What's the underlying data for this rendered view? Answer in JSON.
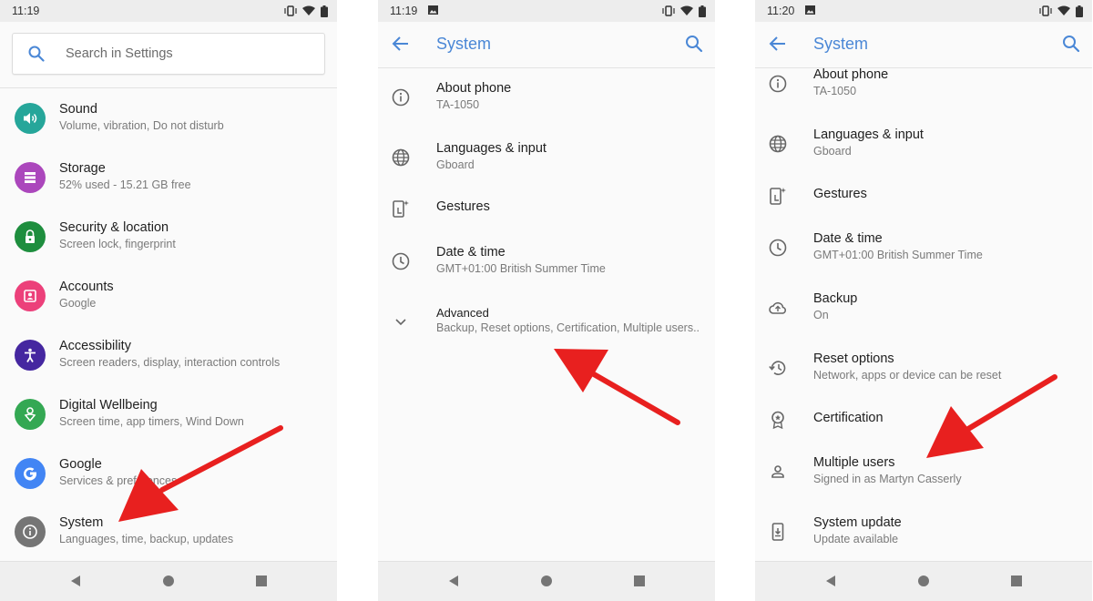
{
  "screens": [
    {
      "status_time": "11:19",
      "search_placeholder": "Search in Settings",
      "items": [
        {
          "title": "Sound",
          "sub": "Volume, vibration, Do not disturb",
          "icon": "volume-icon",
          "color": "#26a69a"
        },
        {
          "title": "Storage",
          "sub": "52% used - 15.21 GB free",
          "icon": "storage-icon",
          "color": "#ab47bc"
        },
        {
          "title": "Security & location",
          "sub": "Screen lock, fingerprint",
          "icon": "lock-icon",
          "color": "#1e8e3e"
        },
        {
          "title": "Accounts",
          "sub": "Google",
          "icon": "account-box-icon",
          "color": "#ec407a"
        },
        {
          "title": "Accessibility",
          "sub": "Screen readers, display, interaction controls",
          "icon": "accessibility-icon",
          "color": "#4527a0"
        },
        {
          "title": "Digital Wellbeing",
          "sub": "Screen time, app timers, Wind Down",
          "icon": "wellbeing-icon",
          "color": "#34a853"
        },
        {
          "title": "Google",
          "sub": "Services & preferences",
          "icon": "google-icon",
          "color": "#4285f4"
        },
        {
          "title": "System",
          "sub": "Languages, time, backup, updates",
          "icon": "info-icon",
          "color": "#757575"
        }
      ]
    },
    {
      "status_time": "11:19",
      "title": "System",
      "items": [
        {
          "title": "About phone",
          "sub": "TA-1050",
          "icon": "info-outline-icon"
        },
        {
          "title": "Languages & input",
          "sub": "Gboard",
          "icon": "globe-icon"
        },
        {
          "title": "Gestures",
          "sub": "",
          "icon": "gestures-icon"
        },
        {
          "title": "Date & time",
          "sub": "GMT+01:00 British Summer Time",
          "icon": "clock-icon"
        },
        {
          "title": "Advanced",
          "sub": "Backup, Reset options, Certification, Multiple users..",
          "icon": "chevron-down-icon"
        }
      ]
    },
    {
      "status_time": "11:20",
      "title": "System",
      "items": [
        {
          "title": "About phone",
          "sub": "TA-1050",
          "icon": "info-outline-icon"
        },
        {
          "title": "Languages & input",
          "sub": "Gboard",
          "icon": "globe-icon"
        },
        {
          "title": "Gestures",
          "sub": "",
          "icon": "gestures-icon"
        },
        {
          "title": "Date & time",
          "sub": "GMT+01:00 British Summer Time",
          "icon": "clock-icon"
        },
        {
          "title": "Backup",
          "sub": "On",
          "icon": "cloud-upload-icon"
        },
        {
          "title": "Reset options",
          "sub": "Network, apps or device can be reset",
          "icon": "history-icon"
        },
        {
          "title": "Certification",
          "sub": "",
          "icon": "certificate-icon"
        },
        {
          "title": "Multiple users",
          "sub": "Signed in as Martyn Casserly",
          "icon": "person-icon"
        },
        {
          "title": "System update",
          "sub": "Update available",
          "icon": "system-update-icon"
        }
      ]
    }
  ],
  "colors": {
    "accent": "#4a87d6",
    "annotation_arrow": "#e8201f"
  }
}
